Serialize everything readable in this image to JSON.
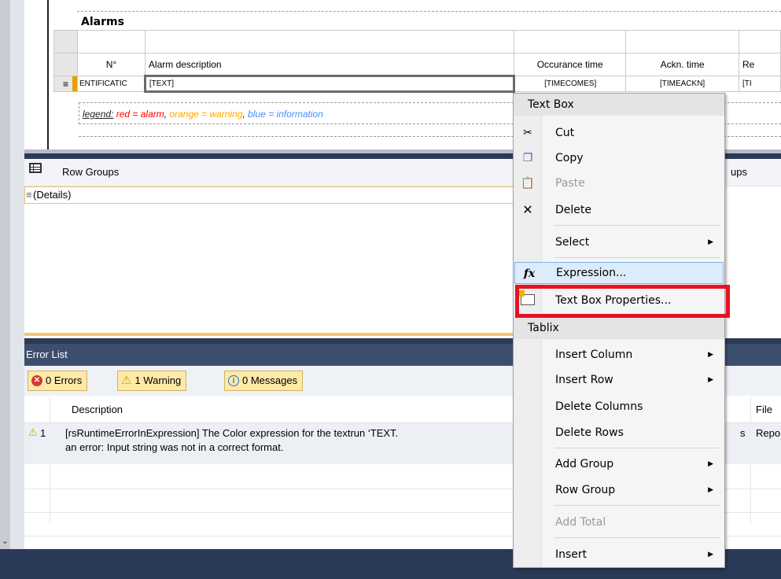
{
  "report": {
    "title": "Alarms",
    "columns": {
      "number": "N°",
      "description": "Alarm description",
      "occurrence": "Occurance time",
      "ackn": "Ackn. time",
      "re": "Re"
    },
    "row": {
      "handle": "≡",
      "number": "ENTIFICATIC",
      "description": "[TEXT]",
      "occurrence": "[TIMECOMES]",
      "ackn": "[TIMEACKN]",
      "re": "[TI"
    },
    "legend": {
      "label": "legend:",
      "red": "red = alarm",
      "sep1": ", ",
      "orange": "orange = warning",
      "sep2": ", ",
      "blue": "blue = information",
      "colors": {
        "red": "#ff0000",
        "orange": "#ffa500",
        "blue": "#4a8df8"
      }
    }
  },
  "row_groups": {
    "title": "Row Groups",
    "details": "(Details)",
    "details_icon": "≡",
    "partial_col_groups": "ups"
  },
  "error_list": {
    "title": "Error List",
    "filters": {
      "errors": "0 Errors",
      "warnings": "1 Warning",
      "messages": "0 Messages"
    },
    "columns": {
      "description": "Description",
      "file": "File"
    },
    "rows": [
      {
        "index": "1",
        "description_line1": "[rsRuntimeErrorInExpression] The Color expression for the textrun ‘TEXT.",
        "description_line2": "an error: Input string was not in a correct format.",
        "partial": "s",
        "file": "Repo"
      }
    ]
  },
  "context_menu": {
    "header_textbox": "Text Box",
    "cut": "Cut",
    "copy": "Copy",
    "paste": "Paste",
    "delete": "Delete",
    "select": "Select",
    "expression": "Expression...",
    "textbox_properties": "Text Box Properties...",
    "header_tablix": "Tablix",
    "insert_column": "Insert Column",
    "insert_row": "Insert Row",
    "delete_columns": "Delete Columns",
    "delete_rows": "Delete Rows",
    "add_group": "Add Group",
    "row_group": "Row Group",
    "add_total": "Add Total",
    "insert": "Insert",
    "submenu_arrow": "▶"
  },
  "icons": {
    "scroll_down": "⌄",
    "cut": "scissors-icon",
    "copy": "copy-icon",
    "paste": "paste-icon",
    "delete": "delete-x-icon",
    "expression": "fx-icon",
    "properties": "textbox-properties-icon",
    "row_groups": "row-groups-icon",
    "error": "error-icon",
    "warning": "warning-icon",
    "info": "info-icon"
  },
  "colors": {
    "highlight_box": "#e81123",
    "selection_accent": "#e8a100",
    "error_list_title_bg": "#3c4e6e",
    "filter_button_bg": "#fde9a8"
  }
}
